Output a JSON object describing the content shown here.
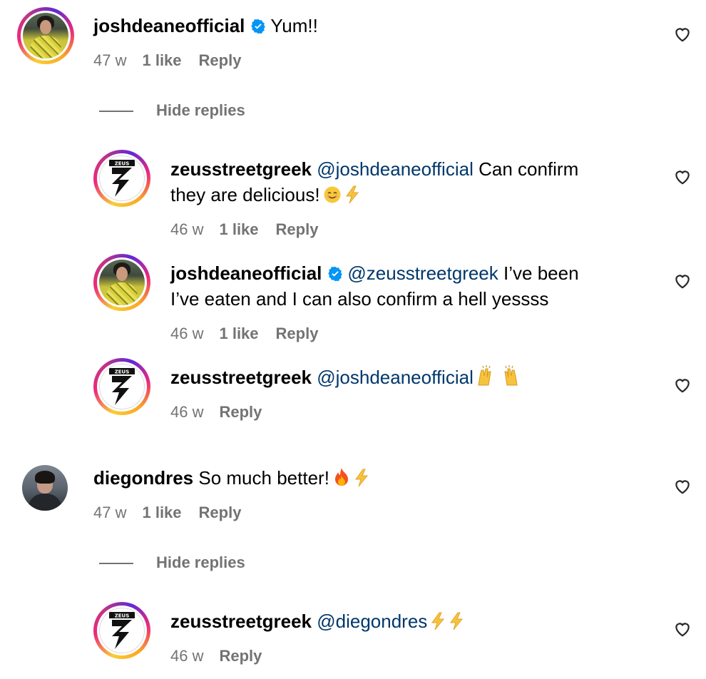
{
  "comments": [
    {
      "username": "joshdeaneofficial",
      "verified": true,
      "text": "Yum!!",
      "time": "47 w",
      "likes": "1 like",
      "reply_label": "Reply",
      "avatar": "joshdeane-avatar"
    },
    {
      "hide_replies_label": "Hide replies"
    },
    {
      "username": "zeusstreetgreek",
      "mention": "@joshdeaneofficial",
      "text_line1": "Can confirm",
      "text_line2": "they are delicious!",
      "emoji": [
        "smiling-face-emoji",
        "lightning-emoji"
      ],
      "time": "46 w",
      "likes": "1 like",
      "reply_label": "Reply",
      "avatar": "zeus-logo-avatar"
    },
    {
      "username": "joshdeaneofficial",
      "verified": true,
      "mention": "@zeusstreetgreek",
      "text_line1": "I’ve been",
      "text_line2": "I’ve eaten and I can also confirm a hell yessss",
      "time": "46 w",
      "likes": "1 like",
      "reply_label": "Reply",
      "avatar": "joshdeane-avatar"
    },
    {
      "username": "zeusstreetgreek",
      "mention": "@joshdeaneofficial",
      "emoji": [
        "raising-hands-emoji"
      ],
      "time": "46 w",
      "reply_label": "Reply",
      "avatar": "zeus-logo-avatar"
    },
    {
      "username": "diegondres",
      "text": "So much better!",
      "emoji": [
        "fire-emoji",
        "lightning-emoji"
      ],
      "time": "47 w",
      "likes": "1 like",
      "reply_label": "Reply",
      "avatar": "diegondres-avatar"
    },
    {
      "hide_replies_label": "Hide replies"
    },
    {
      "username": "zeusstreetgreek",
      "mention": "@diegondres",
      "emoji": [
        "lightning-emoji",
        "lightning-emoji"
      ],
      "time": "46 w",
      "reply_label": "Reply",
      "avatar": "zeus-logo-avatar"
    }
  ],
  "zeus_logo_text": "ZEUS",
  "colors": {
    "mention": "#00376b",
    "meta": "#737373",
    "verified": "#0095f6",
    "text": "#000000"
  }
}
